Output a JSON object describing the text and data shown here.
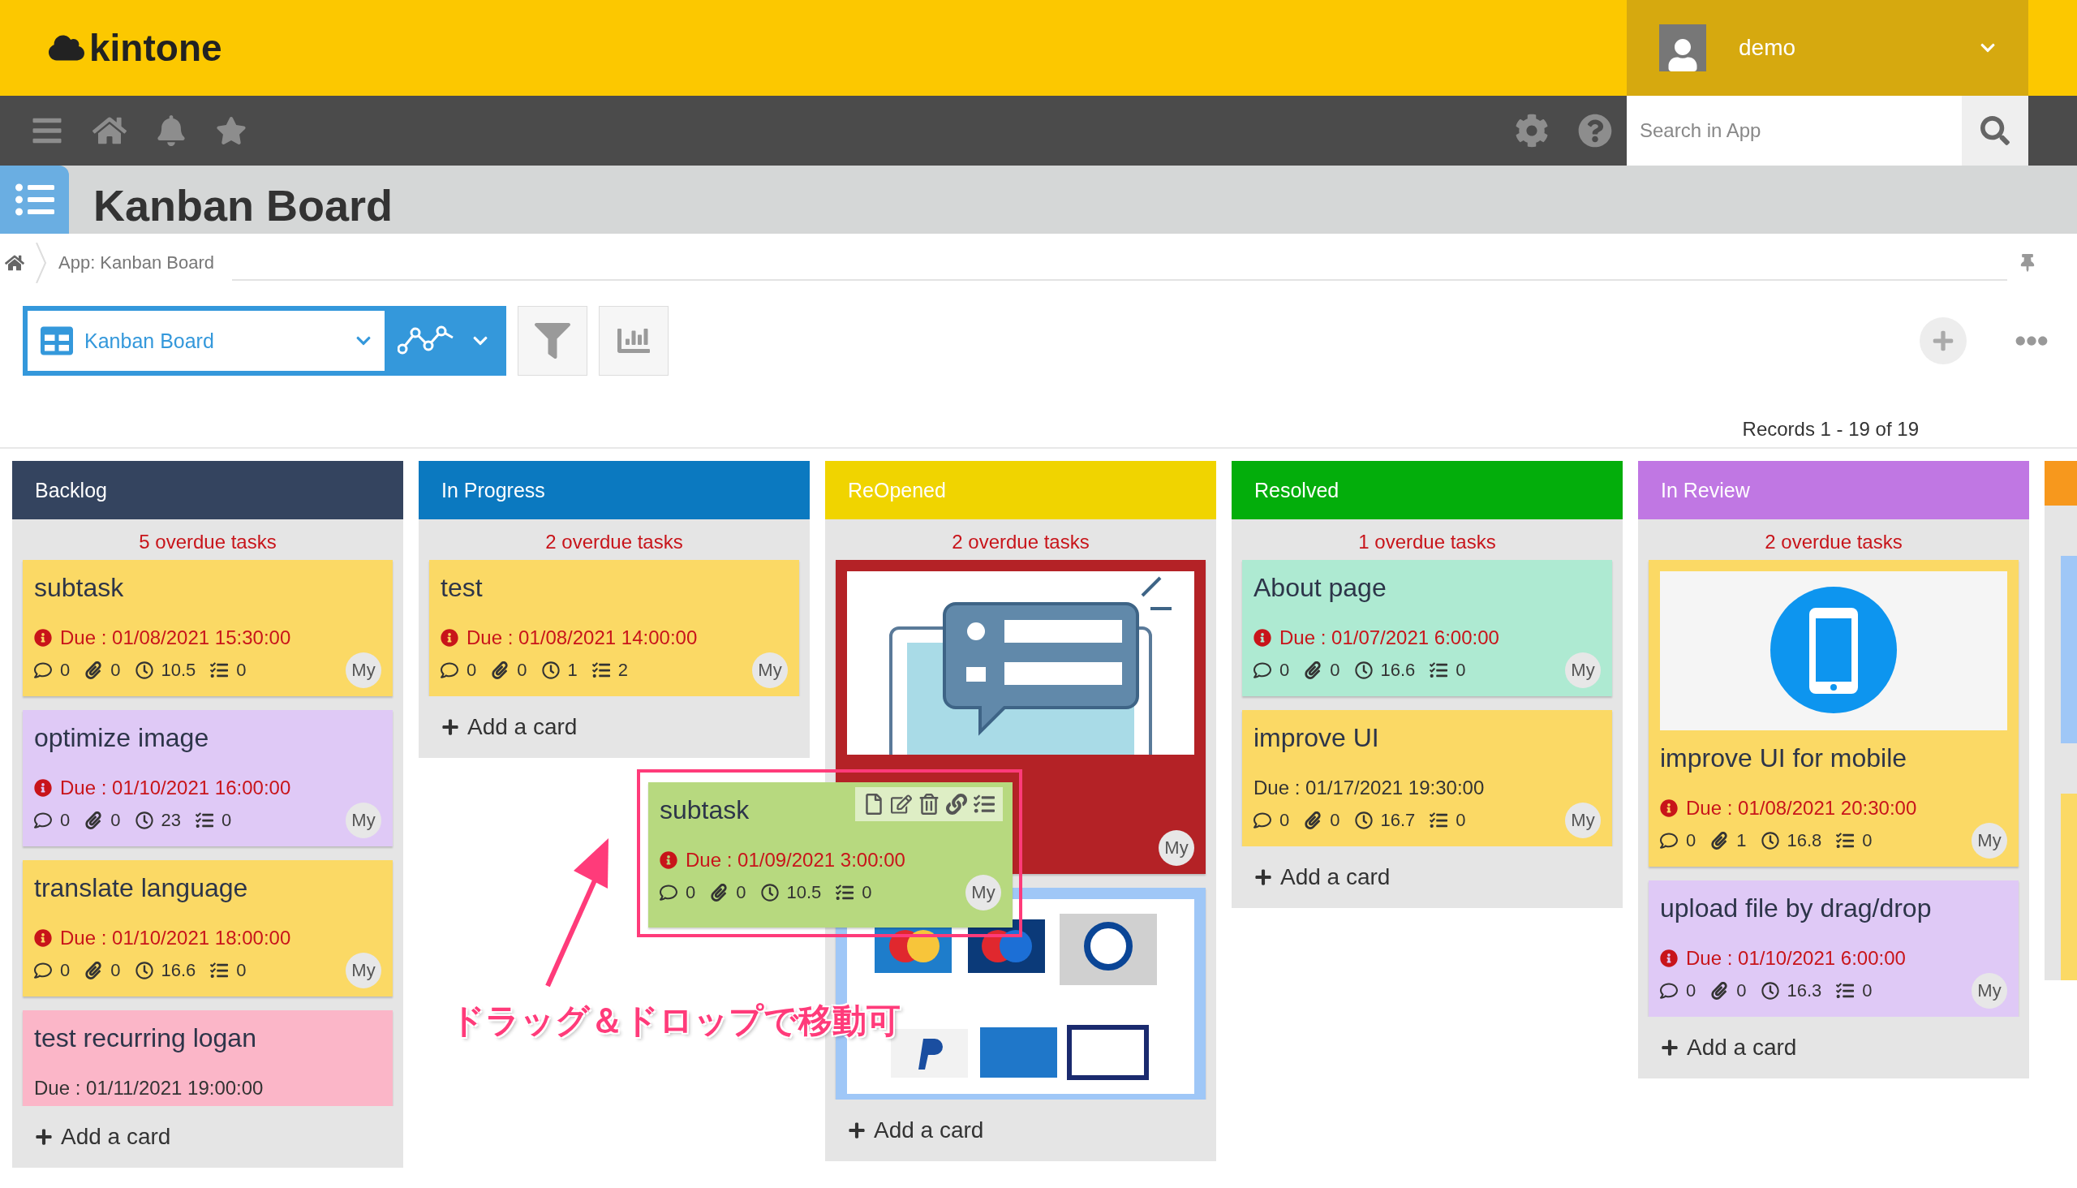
{
  "header": {
    "logo": "kintone",
    "user": "demo"
  },
  "nav": {
    "search": {
      "placeholder": "Search in App"
    }
  },
  "app_title": "Kanban Board",
  "breadcrumb": "App: Kanban Board",
  "toolbar": {
    "view": "Kanban Board"
  },
  "records": "Records 1 - 19 of 19",
  "columns": [
    {
      "title": "Backlog",
      "color": "#34445f",
      "overdue": "5 overdue tasks",
      "add": "Add a card",
      "cards": [
        {
          "title": "subtask",
          "color": "#fbd965",
          "due": "Due : 01/08/2021 15:30:00",
          "overdue": true,
          "metrics": {
            "comments": "0",
            "attachments": "0",
            "hours": "10.5",
            "subtasks": "0"
          },
          "avatar": "My"
        },
        {
          "title": "optimize image",
          "color": "#dfc9f6",
          "due": "Due : 01/10/2021 16:00:00",
          "overdue": true,
          "metrics": {
            "comments": "0",
            "attachments": "0",
            "hours": "23",
            "subtasks": "0"
          },
          "avatar": "My"
        },
        {
          "title": "translate language",
          "color": "#fbd965",
          "due": "Due : 01/10/2021 18:00:00",
          "overdue": true,
          "metrics": {
            "comments": "0",
            "attachments": "0",
            "hours": "16.6",
            "subtasks": "0"
          },
          "avatar": "My"
        },
        {
          "title": "test recurring logan",
          "color": "#fbb6c8",
          "due": "Due : 01/11/2021 19:00:00",
          "overdue": false
        }
      ]
    },
    {
      "title": "In Progress",
      "color": "#0b79c0",
      "overdue": "2 overdue tasks",
      "add": "Add a card",
      "cards": [
        {
          "title": "test",
          "color": "#fbd965",
          "due": "Due : 01/08/2021 14:00:00",
          "overdue": true,
          "metrics": {
            "comments": "0",
            "attachments": "0",
            "hours": "1",
            "subtasks": "2"
          },
          "avatar": "My"
        }
      ]
    },
    {
      "title": "ReOpened",
      "color": "#f0d400",
      "overdue": "2 overdue tasks",
      "add": "Add a card",
      "cards": [
        {
          "color": "#b42226",
          "avatar": "My"
        },
        {
          "color": "#9fc7f7"
        }
      ]
    },
    {
      "title": "Resolved",
      "color": "#03ae0b",
      "overdue": "1 overdue tasks",
      "add": "Add a card",
      "cards": [
        {
          "title": "About page",
          "color": "#aeead2",
          "due": "Due : 01/07/2021 6:00:00",
          "overdue": true,
          "metrics": {
            "comments": "0",
            "attachments": "0",
            "hours": "16.6",
            "subtasks": "0"
          },
          "avatar": "My"
        },
        {
          "title": "improve UI",
          "color": "#fbd965",
          "due": "Due : 01/17/2021 19:30:00",
          "overdue": false,
          "metrics": {
            "comments": "0",
            "attachments": "0",
            "hours": "16.7",
            "subtasks": "0"
          },
          "avatar": "My"
        }
      ]
    },
    {
      "title": "In Review",
      "color": "#c077e3",
      "overdue": "2 overdue tasks",
      "add": "Add a card",
      "cards": [
        {
          "title": "improve UI for mobile",
          "color": "#fbd965",
          "due": "Due : 01/08/2021 20:30:00",
          "overdue": true,
          "metrics": {
            "comments": "0",
            "attachments": "1",
            "hours": "16.8",
            "subtasks": "0"
          },
          "avatar": "My"
        },
        {
          "title": "upload file by drag/drop",
          "color": "#dfc9f6",
          "due": "Due : 01/10/2021 6:00:00",
          "overdue": true,
          "metrics": {
            "comments": "0",
            "attachments": "0",
            "hours": "16.3",
            "subtasks": "0"
          },
          "avatar": "My"
        }
      ]
    }
  ],
  "next_column": {
    "color": "#f7981d",
    "cards": [
      {
        "color": "#9fc7f7"
      },
      {
        "color": "#fbd965"
      }
    ]
  },
  "dragged_card": {
    "title": "subtask",
    "color": "#b7d97f",
    "due": "Due : 01/09/2021 3:00:00",
    "overdue": true,
    "metrics": {
      "comments": "0",
      "attachments": "0",
      "hours": "10.5",
      "subtasks": "0"
    },
    "avatar": "My"
  },
  "annotation": "ドラッグ＆ドロップで移動可"
}
